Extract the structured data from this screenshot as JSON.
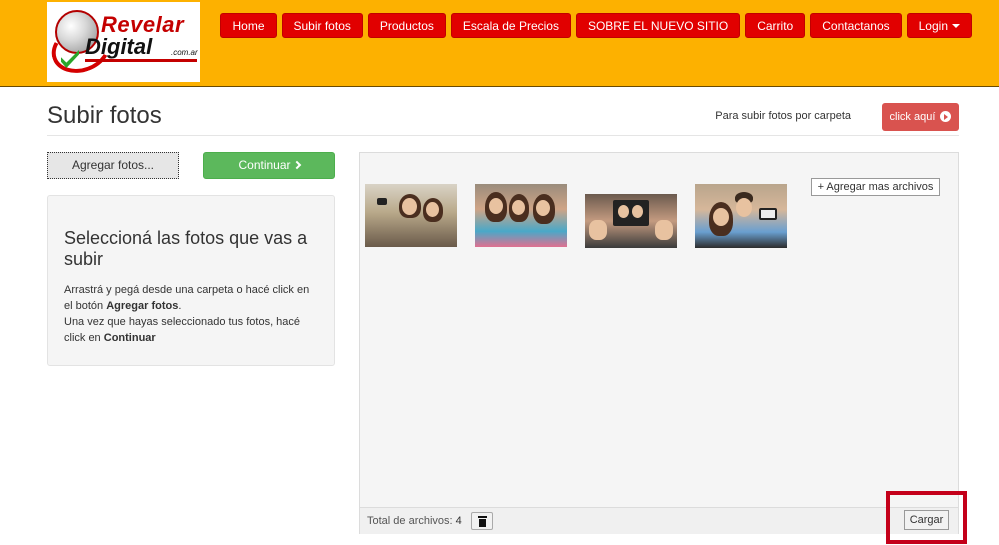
{
  "brand": {
    "name_line1": "Revelar",
    "name_line2": "Digital",
    "domain_suffix": ".com.ar",
    "colors": {
      "header_bg": "#fdb100",
      "nav_bg": "#e10000",
      "danger": "#d9534f",
      "success": "#5cb85c"
    }
  },
  "nav": {
    "items": [
      {
        "label": "Home"
      },
      {
        "label": "Subir fotos"
      },
      {
        "label": "Productos"
      },
      {
        "label": "Escala de Precios"
      },
      {
        "label": "SOBRE EL NUEVO SITIO"
      },
      {
        "label": "Carrito"
      },
      {
        "label": "Contactanos"
      }
    ],
    "login_label": "Login"
  },
  "page": {
    "title": "Subir fotos",
    "folder_hint": "Para subir fotos por carpeta",
    "click_label": "click aquí"
  },
  "left": {
    "add_label": "Agregar fotos...",
    "continue_label": "Continuar",
    "info_heading": "Seleccioná las fotos que vas a subir",
    "info_line1_pre": "Arrastrá y pegá desde una carpeta o hacé click en el botón ",
    "info_line1_bold": "Agregar fotos",
    "info_line1_post": ".",
    "info_line2_pre": "Una vez que hayas seleccionado tus fotos, hacé click en ",
    "info_line2_bold": "Continuar"
  },
  "upload": {
    "thumbnails": [
      {
        "subject": "selfie-photo"
      },
      {
        "subject": "selfie-photo"
      },
      {
        "subject": "selfie-photo"
      },
      {
        "subject": "selfie-photo"
      }
    ],
    "add_more_label": "+ Agregar mas archivos",
    "total_label": "Total de archivos:",
    "total_count": "4",
    "load_label": "Cargar"
  },
  "icons": {
    "trash": "trash-icon",
    "chevron": "chevron-right-icon",
    "arrow": "arrow-circle-right-icon",
    "caret": "caret-down-icon"
  }
}
